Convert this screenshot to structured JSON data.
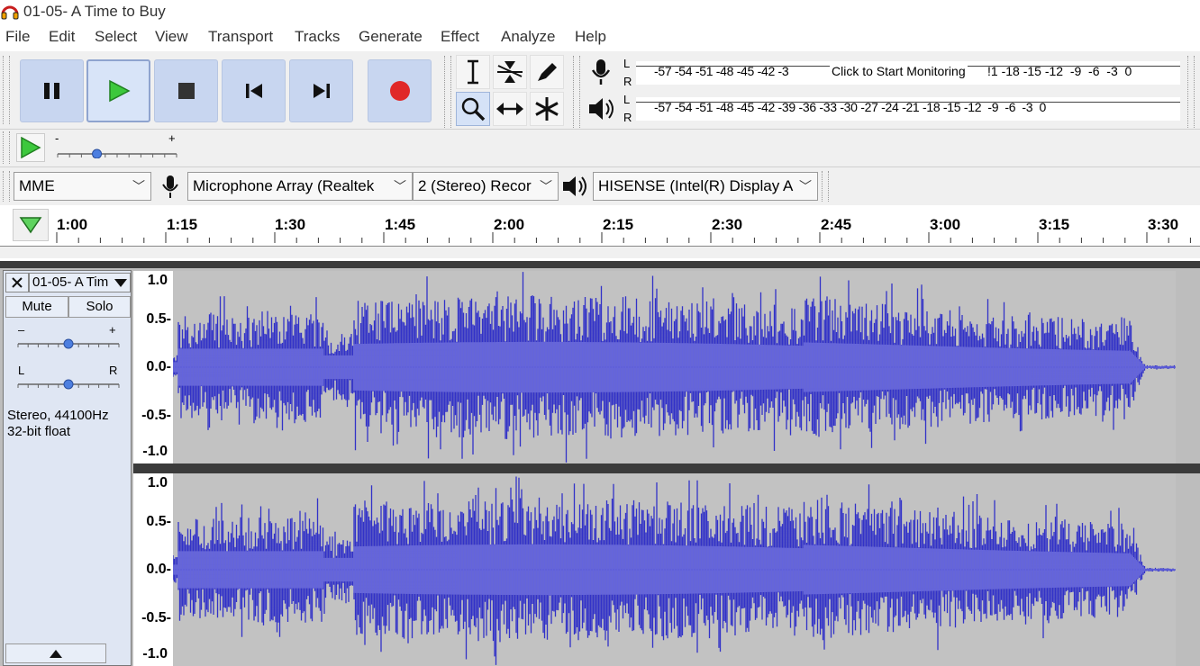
{
  "window": {
    "title": "01-05- A Time to Buy"
  },
  "menu": [
    "File",
    "Edit",
    "Select",
    "View",
    "Transport",
    "Tracks",
    "Generate",
    "Effect",
    "Analyze",
    "Help"
  ],
  "transport": {
    "buttons": [
      "pause-icon",
      "play-icon",
      "stop-icon",
      "skip-to-start-icon",
      "skip-to-end-icon",
      "record-icon"
    ]
  },
  "tools": [
    "selection-tool-icon",
    "envelope-tool-icon",
    "draw-tool-icon",
    "zoom-tool-icon",
    "time-shift-tool-icon",
    "multi-tool-icon"
  ],
  "meters": {
    "record": {
      "l": "L",
      "r": "R",
      "scale": "-57 -54 -51 -48 -45 -42 -3",
      "prompt": "Click to Start Monitoring",
      "scale_right": "!1 -18 -15 -12  -9  -6  -3  0"
    },
    "playback": {
      "l": "L",
      "r": "R",
      "scale": "-57 -54 -51 -48 -45 -42 -39 -36 -33 -30 -27 -24 -21 -18 -15 -12  -9  -6  -3  0"
    }
  },
  "play_speed": {
    "minus": "-",
    "plus": "+",
    "level": 0.33
  },
  "devices": {
    "host": "MME",
    "recording_device": "Microphone Array (Realtek",
    "channels": "2 (Stereo) Recor",
    "playback_device": "HISENSE (Intel(R) Display A"
  },
  "timeline": {
    "labels": [
      "1:00",
      "1:15",
      "1:30",
      "1:45",
      "2:00",
      "2:15",
      "2:30",
      "2:45",
      "3:00",
      "3:15",
      "3:30"
    ]
  },
  "track": {
    "name": "01-05- A Tim",
    "mute": "Mute",
    "solo": "Solo",
    "gain": {
      "minus": "–",
      "plus": "+",
      "level": 0.5
    },
    "pan": {
      "left": "L",
      "right": "R",
      "level": 0.5
    },
    "info_line1": "Stereo, 44100Hz",
    "info_line2": "32-bit float",
    "scale_labels": [
      "1.0",
      "0.5-",
      "0.0-",
      "-0.5-",
      "-1.0"
    ]
  },
  "colors": {
    "waveform": "#3232c8",
    "waveform_rms": "#6464dc",
    "accent": "#c8d6f0"
  }
}
